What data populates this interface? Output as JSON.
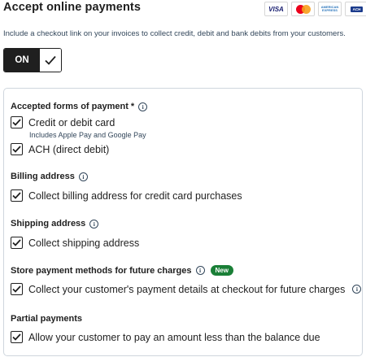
{
  "header": {
    "title": "Accept online payments",
    "description": "Include a checkout link on your invoices to collect credit, debit and bank debits from your customers.",
    "card_logos": [
      {
        "name": "visa-logo",
        "text": "VISA"
      },
      {
        "name": "mastercard-logo",
        "text": ""
      },
      {
        "name": "amex-logo",
        "text": "AMERICAN EXPRESS"
      },
      {
        "name": "ach-logo",
        "text": "ACH"
      }
    ]
  },
  "toggle": {
    "label": "ON",
    "state": true
  },
  "sections": {
    "forms_of_payment": {
      "title": "Accepted forms of payment *",
      "options": [
        {
          "label": "Credit or debit card",
          "checked": true,
          "sublabel": "Includes Apple Pay and Google Pay"
        },
        {
          "label": "ACH (direct debit)",
          "checked": true
        }
      ]
    },
    "billing_address": {
      "title": "Billing address",
      "option": {
        "label": "Collect billing address for credit card purchases",
        "checked": true
      }
    },
    "shipping_address": {
      "title": "Shipping address",
      "option": {
        "label": "Collect shipping address",
        "checked": true
      }
    },
    "store_methods": {
      "title": "Store payment methods for future charges",
      "badge": "New",
      "option": {
        "label": "Collect your customer's payment details at checkout for future charges",
        "checked": true
      }
    },
    "partial_payments": {
      "title": "Partial payments",
      "option": {
        "label": "Allow your customer to pay an amount less than the balance due",
        "checked": true
      }
    }
  },
  "colors": {
    "badge_green": "#1a7f37",
    "text_dark": "#1f1f1f",
    "muted": "#33475b",
    "border": "#cfd6dd"
  }
}
